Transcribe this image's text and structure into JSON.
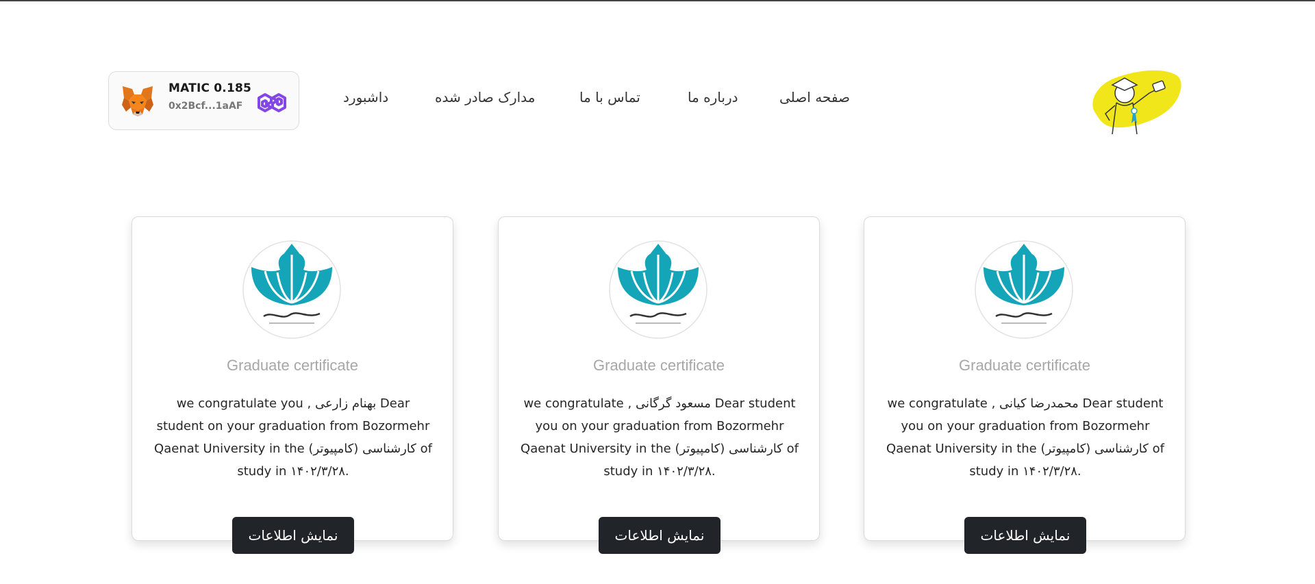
{
  "wallet": {
    "balance": "MATIC 0.185",
    "address": "0x2Bcf...1aAF",
    "wallet_icon": "metamask-fox-icon",
    "network_icon": "polygon-icon"
  },
  "nav": {
    "home": "صفحه اصلی",
    "about": "درباره ما",
    "contact": "تماس با ما",
    "issued_docs": "مدارک صادر شده",
    "dashboard": "داشبورد"
  },
  "logo": {
    "icon": "graduate-illustration-logo",
    "accent": "#f0e619"
  },
  "cards": [
    {
      "seal_icon": "university-seal-icon",
      "title": "Graduate certificate",
      "body": "we congratulate you , بهنام زارعی Dear student on your graduation from Bozormehr Qaenat University in the کارشناسی (کامپیوتر) of study in ۱۴۰۲/۳/۲۸.",
      "button": "نمایش اطلاعات"
    },
    {
      "seal_icon": "university-seal-icon",
      "title": "Graduate certificate",
      "body": "we congratulate , مسعود گرگانی Dear student you on your graduation from Bozormehr Qaenat University in the کارشناسی (کامپیوتر) of study in ۱۴۰۲/۳/۲۸.",
      "button": "نمایش اطلاعات"
    },
    {
      "seal_icon": "university-seal-icon",
      "title": "Graduate certificate",
      "body": "we congratulate , محمدرضا کیانی Dear student you on your graduation from Bozormehr Qaenat University in the کارشناسی (کامپیوتر) of study in ۱۴۰۲/۳/۲۸.",
      "button": "نمایش اطلاعات"
    }
  ],
  "colors": {
    "seal_teal": "#15a5b8",
    "button_bg": "#212529",
    "title_gray": "#a7a7a7"
  }
}
